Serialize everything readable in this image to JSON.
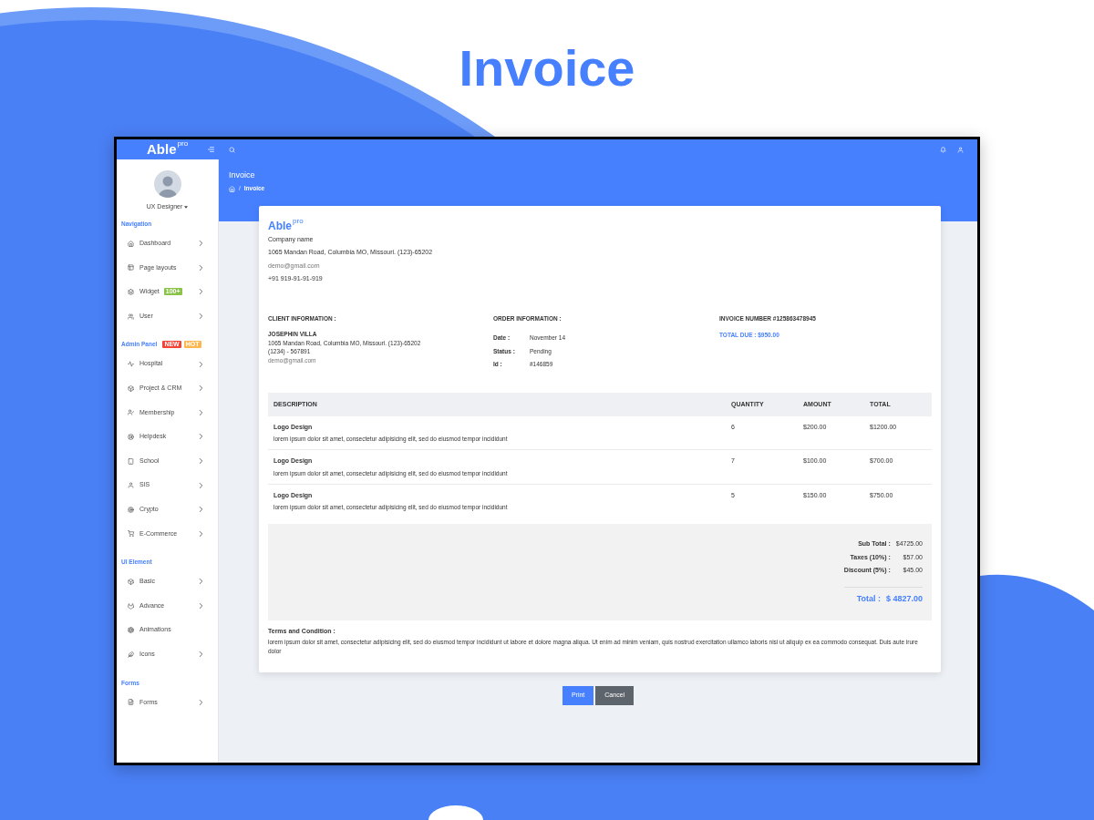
{
  "page_title": "Invoice",
  "topbar": {
    "logo": "Able",
    "logo_badge": "pro"
  },
  "sidebar": {
    "profile": {
      "name": "UX Designer"
    },
    "sections": [
      {
        "title": "Navigation",
        "items": [
          {
            "label": "Dashboard",
            "has_submenu": true
          },
          {
            "label": "Page layouts",
            "has_submenu": true
          },
          {
            "label": "Widget",
            "badge": {
              "text": "100+",
              "color": "#8bc34a"
            },
            "has_submenu": true
          },
          {
            "label": "User",
            "has_submenu": true
          }
        ]
      },
      {
        "title": "Admin Panel",
        "badges": [
          {
            "text": "NEW",
            "color": "#f44236"
          },
          {
            "text": "HOT",
            "color": "#ffb64d"
          }
        ],
        "items": [
          {
            "label": "Hospital",
            "has_submenu": true
          },
          {
            "label": "Project & CRM",
            "has_submenu": true
          },
          {
            "label": "Membership",
            "has_submenu": true
          },
          {
            "label": "Helpdesk",
            "has_submenu": true
          },
          {
            "label": "School",
            "has_submenu": true
          },
          {
            "label": "SIS",
            "has_submenu": true
          },
          {
            "label": "Crypto",
            "has_submenu": true
          },
          {
            "label": "E-Commerce",
            "has_submenu": true
          }
        ]
      },
      {
        "title": "UI Element",
        "items": [
          {
            "label": "Basic",
            "has_submenu": true
          },
          {
            "label": "Advance",
            "has_submenu": true
          },
          {
            "label": "Animations",
            "has_submenu": false
          },
          {
            "label": "Icons",
            "has_submenu": true
          }
        ]
      },
      {
        "title": "Forms",
        "items": [
          {
            "label": "Forms",
            "has_submenu": true
          }
        ]
      }
    ]
  },
  "page_header": {
    "title": "Invoice",
    "breadcrumb": {
      "separator": "/",
      "items": [
        "Invoice"
      ]
    }
  },
  "invoice": {
    "logo": "Able",
    "logo_badge": "pro",
    "company": {
      "name": "Company name",
      "address": "1065 Mandan Road, Columbia MO, Missouri. (123)-65202",
      "email": "demo@gmail.com",
      "phone": "+91 919-91-91-919"
    },
    "client": {
      "heading": "CLIENT INFORMATION :",
      "name": "JOSEPHIN VILLA",
      "address": "1065 Mandan Road, Columbia MO, Missouri. (123)-65202",
      "phone": "(1234) - 567891",
      "email": "demo@gmail.com"
    },
    "order": {
      "heading": "ORDER INFORMATION :",
      "fields": [
        {
          "label": "Date :",
          "value": "November 14"
        },
        {
          "label": "Status :",
          "value": "Pending"
        },
        {
          "label": "Id :",
          "value": "#146859"
        }
      ]
    },
    "invoice_number": "INVOICE NUMBER #125863478945",
    "total_due": "TOTAL DUE : $950.00",
    "table": {
      "columns": [
        "DESCRIPTION",
        "QUANTITY",
        "AMOUNT",
        "TOTAL"
      ],
      "rows": [
        {
          "title": "Logo Design",
          "description": "lorem ipsum dolor sit amet, consectetur adipisicing elit, sed do eiusmod tempor incididunt",
          "quantity": "6",
          "amount": "$200.00",
          "total": "$1200.00"
        },
        {
          "title": "Logo Design",
          "description": "lorem ipsum dolor sit amet, consectetur adipisicing elit, sed do eiusmod tempor incididunt",
          "quantity": "7",
          "amount": "$100.00",
          "total": "$700.00"
        },
        {
          "title": "Logo Design",
          "description": "lorem ipsum dolor sit amet, consectetur adipisicing elit, sed do eiusmod tempor incididunt",
          "quantity": "5",
          "amount": "$150.00",
          "total": "$750.00"
        }
      ]
    },
    "summary": {
      "lines": [
        {
          "label": "Sub Total :",
          "value": "$4725.00"
        },
        {
          "label": "Taxes (10%) :",
          "value": "$57.00"
        },
        {
          "label": "Discount (5%) :",
          "value": "$45.00"
        }
      ],
      "total": {
        "label": "Total :",
        "value": "$ 4827.00"
      }
    },
    "terms": {
      "heading": "Terms and Condition :",
      "text": "lorem ipsum dolor sit amet, consectetur adipisicing elit, sed do eiusmod tempor incididunt ut labore et dolore magna aliqua. Ut enim ad minim veniam, quis nostrud exercitation ullamco laboris nisi ut aliquip ex ea commodo consequat. Duis aute irure dolor"
    }
  },
  "buttons": [
    {
      "label": "Print",
      "kind": "primary"
    },
    {
      "label": "Cancel",
      "kind": "secondary"
    }
  ]
}
